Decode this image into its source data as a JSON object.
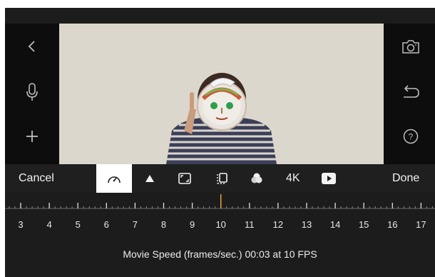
{
  "left_sidebar": {
    "back_icon": "chevron-left",
    "mic_icon": "microphone",
    "add_icon": "plus"
  },
  "right_sidebar": {
    "camera_icon": "camera",
    "undo_icon": "undo-arrow",
    "help_label": "?"
  },
  "toolbar": {
    "cancel_label": "Cancel",
    "done_label": "Done",
    "resolution_label": "4K",
    "active_tool": "speed",
    "active_bg": "#ffffff"
  },
  "ruler": {
    "labels": [
      "3",
      "4",
      "5",
      "6",
      "7",
      "8",
      "9",
      "10",
      "11",
      "12",
      "13",
      "14",
      "15",
      "16",
      "17"
    ],
    "current_value": 10,
    "indicator_color": "#e8a23a"
  },
  "caption": {
    "text": "Movie Speed (frames/sec.) 00:03 at 10 FPS"
  }
}
